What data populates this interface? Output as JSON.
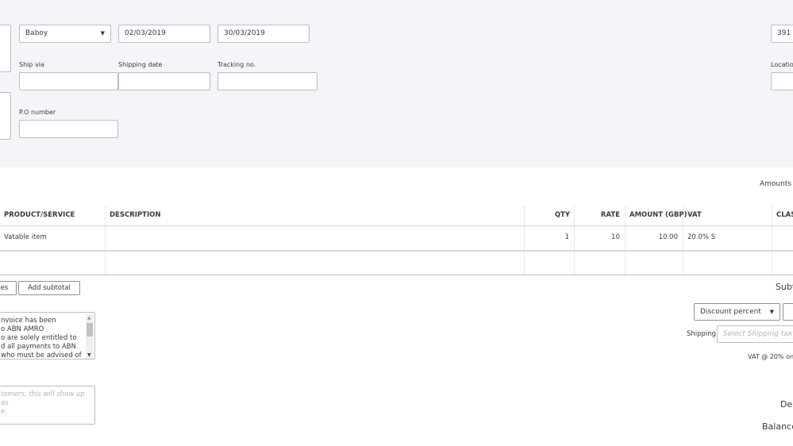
{
  "header": {
    "customer_select": "Baboy",
    "invoice_date": "02/03/2019",
    "due_date": "30/03/2019",
    "invoice_no": "391",
    "ship_via_label": "Ship via",
    "ship_via": "",
    "shipping_date_label": "Shipping date",
    "shipping_date": "",
    "tracking_label": "Tracking no.",
    "tracking": "",
    "location_label": "Locatio",
    "location": "",
    "po_label": "P.O number",
    "po": ""
  },
  "amounts_label": "Amounts",
  "table": {
    "columns": [
      "PRODUCT/SERVICE",
      "DESCRIPTION",
      "QTY",
      "RATE",
      "AMOUNT (GBP)",
      "VAT",
      "CLAS"
    ],
    "rows": [
      {
        "product": "Vatable item",
        "description": "",
        "qty": "1",
        "rate": "10",
        "amount": "10.00",
        "vat": "20.0% S",
        "class": ""
      }
    ]
  },
  "buttons": {
    "clear_lines": "es",
    "add_subtotal": "Add subtotal"
  },
  "message": {
    "lines": [
      "nvoice has been",
      "o ABN AMRO",
      "o are solely entitled to",
      "d all payments to ABN",
      "who must be advised of"
    ]
  },
  "statement_placeholder": {
    "lines": [
      "tomers, this will show up as",
      "e."
    ]
  },
  "totals": {
    "subtotal_label": "Subt",
    "discount_select": "Discount percent",
    "shipping_label": "Shipping",
    "shipping_tax_placeholder": "Select Shipping tax",
    "vat_label": "VAT @ 20% on",
    "deposit_label": "De",
    "balance_label": "Balance"
  }
}
